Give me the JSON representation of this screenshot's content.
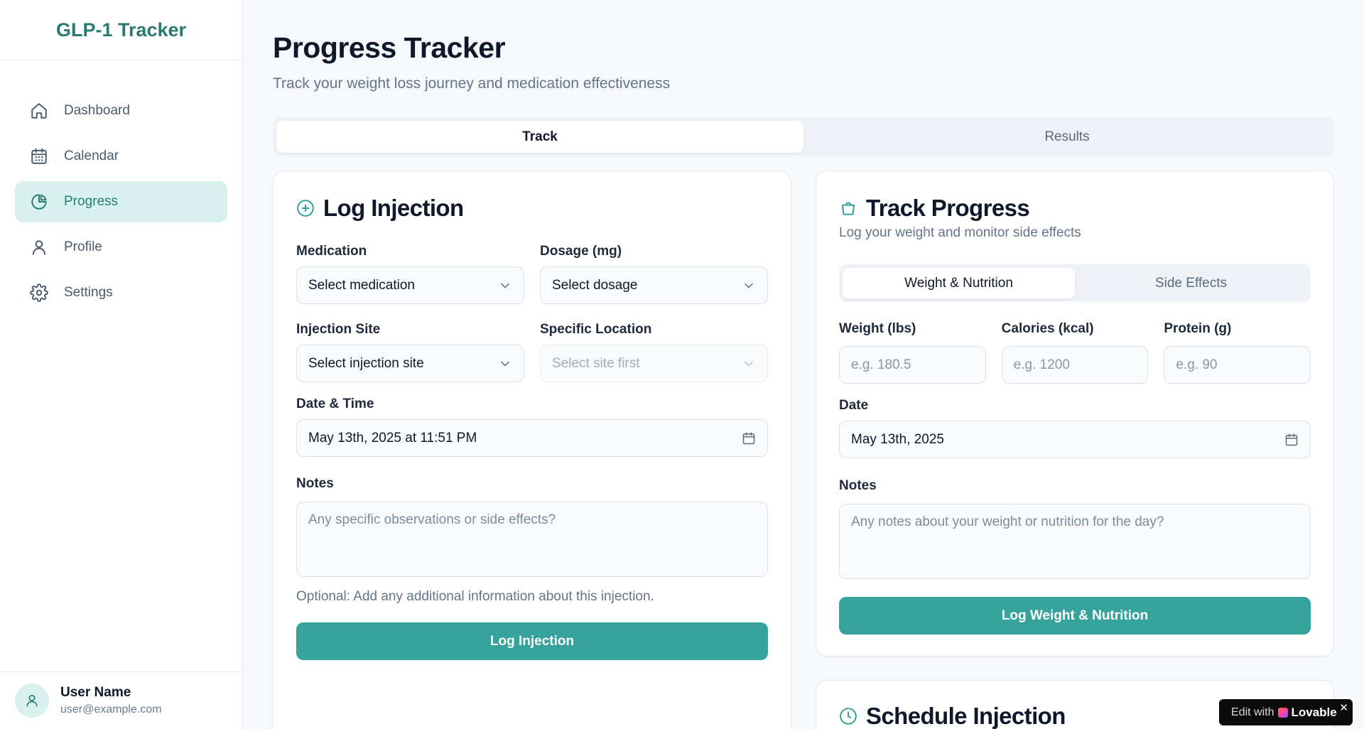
{
  "app": {
    "title": "GLP-1 Tracker"
  },
  "sidebar": {
    "items": [
      {
        "label": "Dashboard",
        "icon": "home-icon",
        "active": false
      },
      {
        "label": "Calendar",
        "icon": "calendar-icon",
        "active": false
      },
      {
        "label": "Progress",
        "icon": "pie-chart-icon",
        "active": true
      },
      {
        "label": "Profile",
        "icon": "user-icon",
        "active": false
      },
      {
        "label": "Settings",
        "icon": "gear-icon",
        "active": false
      }
    ],
    "user": {
      "name": "User Name",
      "email": "user@example.com"
    }
  },
  "page": {
    "title": "Progress Tracker",
    "subtitle": "Track your weight loss journey and medication effectiveness"
  },
  "tabs": [
    {
      "label": "Track",
      "active": true
    },
    {
      "label": "Results",
      "active": false
    }
  ],
  "log_injection": {
    "title": "Log Injection",
    "medication_label": "Medication",
    "medication_placeholder": "Select medication",
    "dosage_label": "Dosage (mg)",
    "dosage_placeholder": "Select dosage",
    "site_label": "Injection Site",
    "site_placeholder": "Select injection site",
    "location_label": "Specific Location",
    "location_placeholder": "Select site first",
    "datetime_label": "Date & Time",
    "datetime_value": "May 13th, 2025 at 11:51 PM",
    "notes_label": "Notes",
    "notes_placeholder": "Any specific observations or side effects?",
    "hint": "Optional: Add any additional information about this injection.",
    "button": "Log Injection"
  },
  "track_progress": {
    "title": "Track Progress",
    "description": "Log your weight and monitor side effects",
    "subtabs": [
      {
        "label": "Weight & Nutrition",
        "active": true
      },
      {
        "label": "Side Effects",
        "active": false
      }
    ],
    "weight_label": "Weight (lbs)",
    "weight_placeholder": "e.g. 180.5",
    "calories_label": "Calories (kcal)",
    "calories_placeholder": "e.g. 1200",
    "protein_label": "Protein (g)",
    "protein_placeholder": "e.g. 90",
    "date_label": "Date",
    "date_value": "May 13th, 2025",
    "notes_label": "Notes",
    "notes_placeholder": "Any notes about your weight or nutrition for the day?",
    "button": "Log Weight & Nutrition"
  },
  "schedule": {
    "title": "Schedule Injection"
  },
  "badge": {
    "edit": "Edit with",
    "brand": "Lovable",
    "close": "✕"
  },
  "colors": {
    "accent": "#35a29b",
    "brand": "#2a7a72",
    "active_bg": "#d8f1ef"
  }
}
